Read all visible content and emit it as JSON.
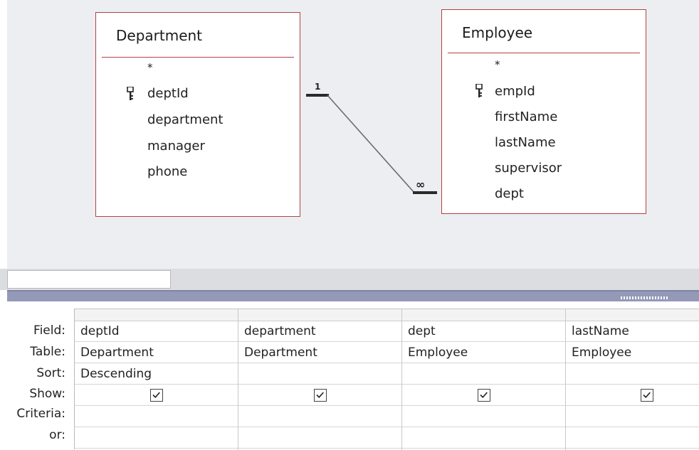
{
  "design": {
    "department_table": {
      "title": "Department",
      "fields": [
        "*",
        "deptId",
        "department",
        "manager",
        "phone"
      ],
      "key_field": "deptId"
    },
    "employee_table": {
      "title": "Employee",
      "fields": [
        "*",
        "empId",
        "firstName",
        "lastName",
        "supervisor",
        "dept"
      ],
      "key_field": "empId"
    },
    "relationship": {
      "one_label": "1",
      "many_label": "∞"
    }
  },
  "grid": {
    "row_labels": {
      "field": "Field:",
      "table": "Table:",
      "sort": "Sort:",
      "show": "Show:",
      "criteria": "Criteria:",
      "or": "or:"
    },
    "columns": [
      {
        "field": "deptId",
        "table": "Department",
        "sort": "Descending",
        "show": true,
        "criteria": "",
        "or": ""
      },
      {
        "field": "department",
        "table": "Department",
        "sort": "",
        "show": true,
        "criteria": "",
        "or": ""
      },
      {
        "field": "dept",
        "table": "Employee",
        "sort": "",
        "show": true,
        "criteria": "",
        "or": ""
      },
      {
        "field": "lastName",
        "table": "Employee",
        "sort": "",
        "show": true,
        "criteria": "",
        "or": ""
      }
    ]
  },
  "icons": {
    "primary_key": "key-icon",
    "show_checkbox": "checkbox-checked-icon"
  },
  "colors": {
    "table_border": "#b1443f",
    "design_background": "#eceef2",
    "splitter": "#9499b8"
  }
}
